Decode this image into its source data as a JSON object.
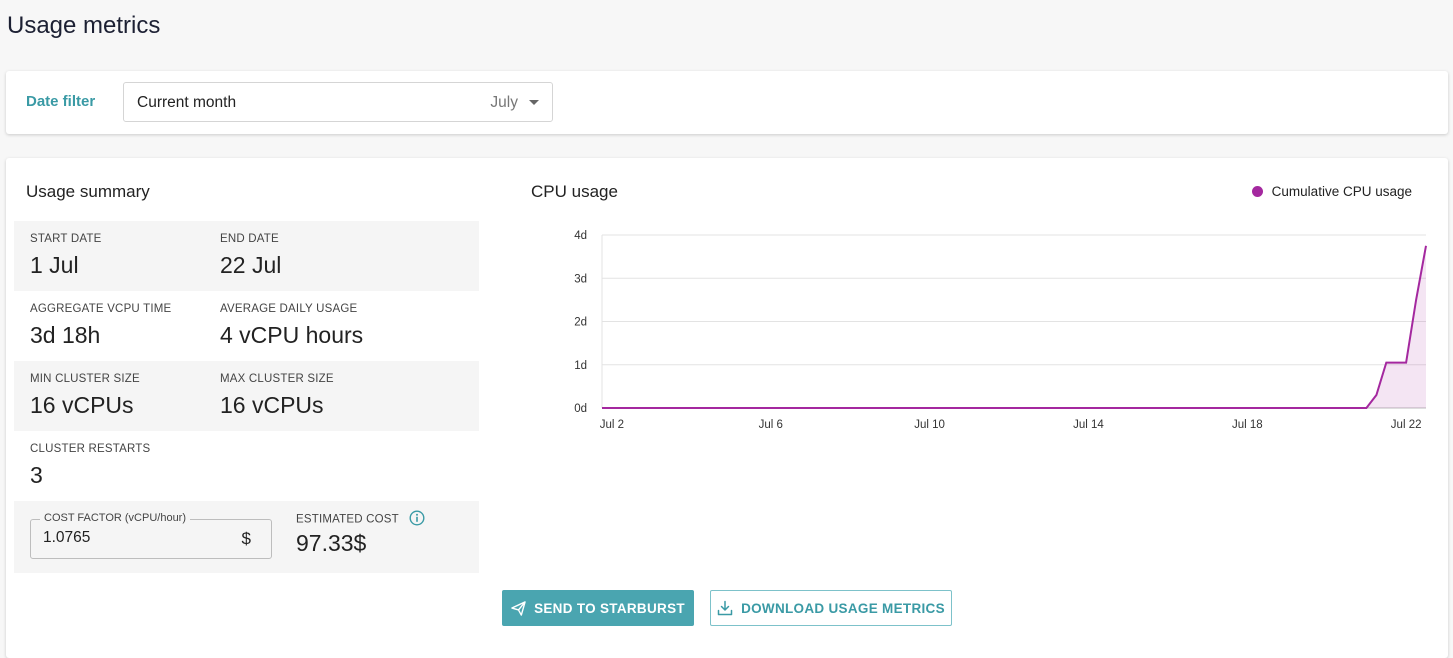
{
  "page": {
    "title": "Usage metrics"
  },
  "filter": {
    "label": "Date filter",
    "value": "Current month",
    "month": "July"
  },
  "summary": {
    "title": "Usage summary",
    "start_date": {
      "label": "START DATE",
      "value": "1 Jul"
    },
    "end_date": {
      "label": "END DATE",
      "value": "22 Jul"
    },
    "aggregate": {
      "label": "AGGREGATE VCPU TIME",
      "value": "3d 18h"
    },
    "average": {
      "label": "AVERAGE DAILY USAGE",
      "value": "4 vCPU hours"
    },
    "min_cluster": {
      "label": "MIN CLUSTER SIZE",
      "value": "16 vCPUs"
    },
    "max_cluster": {
      "label": "MAX CLUSTER SIZE",
      "value": "16 vCPUs"
    },
    "restarts": {
      "label": "CLUSTER RESTARTS",
      "value": "3"
    },
    "cost_factor": {
      "label": "COST FACTOR (vCPU/hour)",
      "value": "1.0765",
      "unit": "$"
    },
    "estimated_cost": {
      "label": "ESTIMATED COST",
      "value": "97.33$",
      "icon": "info-icon"
    }
  },
  "chart": {
    "title": "CPU usage",
    "legend": "Cumulative CPU usage",
    "color": "#a4289f"
  },
  "chart_data": {
    "type": "area",
    "title": "CPU usage",
    "xlabel": "",
    "ylabel": "",
    "x_ticks": [
      "Jul 2",
      "Jul 6",
      "Jul 10",
      "Jul 14",
      "Jul 18",
      "Jul 22"
    ],
    "y_ticks": [
      "0d",
      "1d",
      "2d",
      "3d",
      "4d"
    ],
    "ylim": [
      0,
      4
    ],
    "xlim": [
      1.75,
      22.5
    ],
    "grid": true,
    "legend_position": "top-right",
    "series": [
      {
        "name": "Cumulative CPU usage",
        "x": [
          1.75,
          2,
          4,
          6,
          8,
          10,
          12,
          14,
          16,
          18,
          20,
          21,
          21.25,
          21.5,
          21.75,
          22,
          22.25,
          22.5
        ],
        "y": [
          0,
          0,
          0,
          0,
          0,
          0,
          0,
          0,
          0,
          0,
          0,
          0,
          0.3,
          1.05,
          1.05,
          1.05,
          2.5,
          3.75
        ]
      }
    ]
  },
  "actions": {
    "send": "SEND TO STARBURST",
    "download": "DOWNLOAD USAGE METRICS"
  }
}
